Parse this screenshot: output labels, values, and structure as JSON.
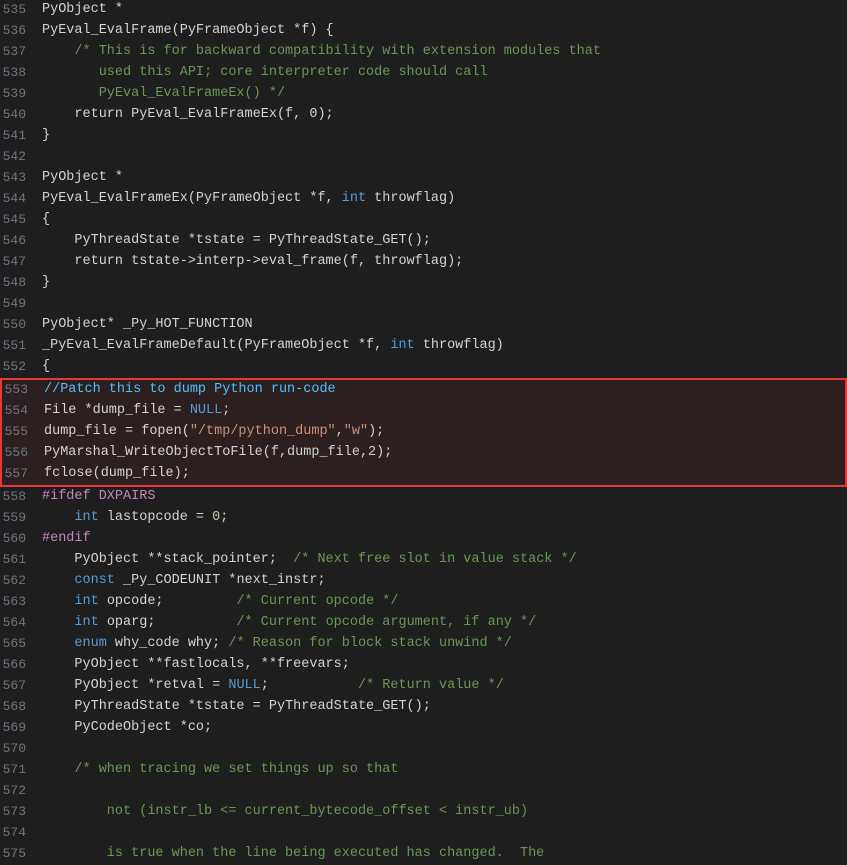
{
  "lines": [
    {
      "num": 535,
      "content": [
        {
          "t": "PyObject *",
          "c": "plain"
        }
      ],
      "highlight": false
    },
    {
      "num": 536,
      "content": [
        {
          "t": "PyEval_EvalFrame(PyFrameObject *f) {",
          "c": "plain"
        }
      ],
      "highlight": false
    },
    {
      "num": 537,
      "content": [
        {
          "t": "    /* This is for backward compatibility with extension modules that",
          "c": "cmt"
        }
      ],
      "highlight": false
    },
    {
      "num": 538,
      "content": [
        {
          "t": "       used this API; core interpreter code should call",
          "c": "cmt"
        }
      ],
      "highlight": false
    },
    {
      "num": 539,
      "content": [
        {
          "t": "       PyEval_EvalFrameEx() */",
          "c": "cmt"
        }
      ],
      "highlight": false
    },
    {
      "num": 540,
      "content": [
        {
          "t": "    return PyEval_EvalFrameEx(f, 0);",
          "c": "plain"
        }
      ],
      "highlight": false
    },
    {
      "num": 541,
      "content": [
        {
          "t": "}",
          "c": "plain"
        }
      ],
      "highlight": false
    },
    {
      "num": 542,
      "content": [
        {
          "t": "",
          "c": "plain"
        }
      ],
      "highlight": false
    },
    {
      "num": 543,
      "content": [
        {
          "t": "PyObject *",
          "c": "plain"
        }
      ],
      "highlight": false
    },
    {
      "num": 544,
      "content": [
        {
          "t": "PyEval_EvalFrameEx(PyFrameObject *f, ",
          "c": "plain"
        },
        {
          "t": "int",
          "c": "kw"
        },
        {
          "t": " throwflag)",
          "c": "plain"
        }
      ],
      "highlight": false
    },
    {
      "num": 545,
      "content": [
        {
          "t": "{",
          "c": "plain"
        }
      ],
      "highlight": false
    },
    {
      "num": 546,
      "content": [
        {
          "t": "    PyThreadState *tstate = PyThreadState_GET();",
          "c": "plain"
        }
      ],
      "highlight": false
    },
    {
      "num": 547,
      "content": [
        {
          "t": "    return tstate->interp->eval_frame(f, throwflag);",
          "c": "plain"
        }
      ],
      "highlight": false
    },
    {
      "num": 548,
      "content": [
        {
          "t": "}",
          "c": "plain"
        }
      ],
      "highlight": false
    },
    {
      "num": 549,
      "content": [
        {
          "t": "",
          "c": "plain"
        }
      ],
      "highlight": false
    },
    {
      "num": 550,
      "content": [
        {
          "t": "PyObject* _Py_HOT_FUNCTION",
          "c": "plain"
        }
      ],
      "highlight": false
    },
    {
      "num": 551,
      "content": [
        {
          "t": "_PyEval_EvalFrameDefault(PyFrameObject *f, ",
          "c": "plain"
        },
        {
          "t": "int",
          "c": "kw"
        },
        {
          "t": " throwflag)",
          "c": "plain"
        }
      ],
      "highlight": false
    },
    {
      "num": 552,
      "content": [
        {
          "t": "{",
          "c": "plain"
        }
      ],
      "highlight": false
    },
    {
      "num": 553,
      "content": [
        {
          "t": "//Patch this to dump Python run-code",
          "c": "patch-comment"
        }
      ],
      "highlight": true,
      "highlight_start": true
    },
    {
      "num": 554,
      "content": [
        {
          "t": "File *dump_file = ",
          "c": "plain"
        },
        {
          "t": "NULL",
          "c": "null-kw"
        },
        {
          "t": ";",
          "c": "plain"
        }
      ],
      "highlight": true
    },
    {
      "num": 555,
      "content": [
        {
          "t": "dump_file = fopen(",
          "c": "plain"
        },
        {
          "t": "\"/tmp/python_dump\"",
          "c": "str"
        },
        {
          "t": ",",
          "c": "plain"
        },
        {
          "t": "\"w\"",
          "c": "str"
        },
        {
          "t": ");",
          "c": "plain"
        }
      ],
      "highlight": true
    },
    {
      "num": 556,
      "content": [
        {
          "t": "PyMarshal_WriteObjectToFile(f,dump_file,2);",
          "c": "plain"
        }
      ],
      "highlight": true
    },
    {
      "num": 557,
      "content": [
        {
          "t": "fclose(dump_file);",
          "c": "plain"
        }
      ],
      "highlight": true,
      "highlight_end": true
    },
    {
      "num": 558,
      "content": [
        {
          "t": "#ifdef DXPAIRS",
          "c": "preproc"
        }
      ],
      "highlight": false
    },
    {
      "num": 559,
      "content": [
        {
          "t": "    ",
          "c": "plain"
        },
        {
          "t": "int",
          "c": "kw"
        },
        {
          "t": " lastopcode = ",
          "c": "plain"
        },
        {
          "t": "0",
          "c": "num"
        },
        {
          "t": ";",
          "c": "plain"
        }
      ],
      "highlight": false
    },
    {
      "num": 560,
      "content": [
        {
          "t": "#endif",
          "c": "preproc"
        }
      ],
      "highlight": false
    },
    {
      "num": 561,
      "content": [
        {
          "t": "    PyObject **stack_pointer;  ",
          "c": "plain"
        },
        {
          "t": "/* Next free slot in value stack */",
          "c": "cmt"
        }
      ],
      "highlight": false
    },
    {
      "num": 562,
      "content": [
        {
          "t": "    ",
          "c": "plain"
        },
        {
          "t": "const",
          "c": "kw"
        },
        {
          "t": " _Py_CODEUNIT *next_instr;",
          "c": "plain"
        }
      ],
      "highlight": false
    },
    {
      "num": 563,
      "content": [
        {
          "t": "    ",
          "c": "plain"
        },
        {
          "t": "int",
          "c": "kw"
        },
        {
          "t": " opcode;         ",
          "c": "plain"
        },
        {
          "t": "/* Current opcode */",
          "c": "cmt"
        }
      ],
      "highlight": false
    },
    {
      "num": 564,
      "content": [
        {
          "t": "    ",
          "c": "plain"
        },
        {
          "t": "int",
          "c": "kw"
        },
        {
          "t": " oparg;          ",
          "c": "plain"
        },
        {
          "t": "/* Current opcode argument, if any */",
          "c": "cmt"
        }
      ],
      "highlight": false
    },
    {
      "num": 565,
      "content": [
        {
          "t": "    ",
          "c": "plain"
        },
        {
          "t": "enum",
          "c": "kw"
        },
        {
          "t": " why_code why; ",
          "c": "plain"
        },
        {
          "t": "/* Reason for block stack unwind */",
          "c": "cmt"
        }
      ],
      "highlight": false
    },
    {
      "num": 566,
      "content": [
        {
          "t": "    PyObject **fastlocals, **freevars;",
          "c": "plain"
        }
      ],
      "highlight": false
    },
    {
      "num": 567,
      "content": [
        {
          "t": "    PyObject *retval = ",
          "c": "plain"
        },
        {
          "t": "NULL",
          "c": "null-kw"
        },
        {
          "t": ";           ",
          "c": "plain"
        },
        {
          "t": "/* Return value */",
          "c": "cmt"
        }
      ],
      "highlight": false
    },
    {
      "num": 568,
      "content": [
        {
          "t": "    PyThreadState *tstate = PyThreadState_GET();",
          "c": "plain"
        }
      ],
      "highlight": false
    },
    {
      "num": 569,
      "content": [
        {
          "t": "    PyCodeObject *co;",
          "c": "plain"
        }
      ],
      "highlight": false
    },
    {
      "num": 570,
      "content": [
        {
          "t": "",
          "c": "plain"
        }
      ],
      "highlight": false
    },
    {
      "num": 571,
      "content": [
        {
          "t": "    ",
          "c": "plain"
        },
        {
          "t": "/* when tracing we set things up so that",
          "c": "cmt"
        }
      ],
      "highlight": false
    },
    {
      "num": 572,
      "content": [
        {
          "t": "",
          "c": "plain"
        }
      ],
      "highlight": false
    },
    {
      "num": 573,
      "content": [
        {
          "t": "        not (instr_lb <= current_bytecode_offset < instr_ub)",
          "c": "cmt"
        }
      ],
      "highlight": false
    },
    {
      "num": 574,
      "content": [
        {
          "t": "",
          "c": "plain"
        }
      ],
      "highlight": false
    },
    {
      "num": 575,
      "content": [
        {
          "t": "        is true when the line being executed has changed.  The",
          "c": "cmt"
        }
      ],
      "highlight": false
    }
  ],
  "colors": {
    "background": "#1e1e1e",
    "highlight_border": "#e53935",
    "highlight_bg": "rgba(229,57,53,0.08)"
  }
}
